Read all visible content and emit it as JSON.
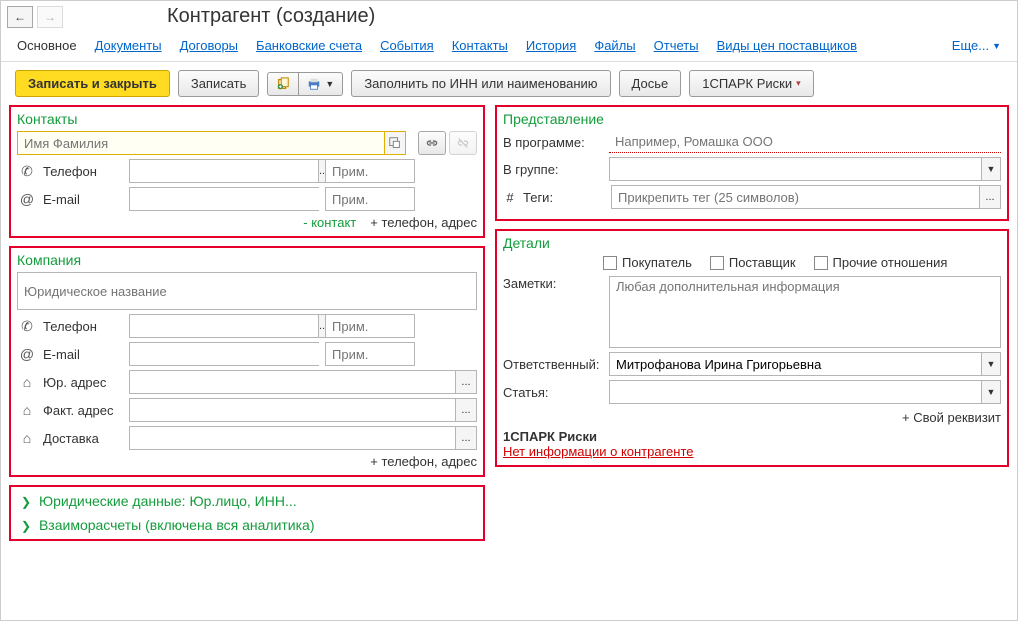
{
  "header": {
    "title": "Контрагент (создание)"
  },
  "tabs": {
    "main": "Основное",
    "docs": "Документы",
    "contracts": "Договоры",
    "bank": "Банковские счета",
    "events": "События",
    "contacts": "Контакты",
    "history": "История",
    "files": "Файлы",
    "reports": "Отчеты",
    "prices": "Виды цен поставщиков",
    "more": "Еще..."
  },
  "toolbar": {
    "save_close": "Записать и закрыть",
    "save": "Записать",
    "fill_inn": "Заполнить по ИНН или наименованию",
    "dossier": "Досье",
    "spark": "1СПАРК Риски"
  },
  "contacts_group": {
    "title": "Контакты",
    "name_placeholder": "Имя Фамилия",
    "phone_label": "Телефон",
    "email_label": "E-mail",
    "note_placeholder": "Прим.",
    "minus_contact": "- контакт",
    "plus_tel": "+ телефон, адрес"
  },
  "company_group": {
    "title": "Компания",
    "name_placeholder": "Юридическое название",
    "phone_label": "Телефон",
    "email_label": "E-mail",
    "legal_addr": "Юр. адрес",
    "fact_addr": "Факт. адрес",
    "delivery": "Доставка",
    "note_placeholder": "Прим.",
    "plus_tel": "+ телефон, адрес"
  },
  "legal_data_link": "Юридические данные: Юр.лицо, ИНН...",
  "settlements_link": "Взаиморасчеты (включена вся аналитика)",
  "repr_group": {
    "title": "Представление",
    "in_app": "В программе:",
    "in_app_ph": "Например, Ромашка ООО",
    "in_group": "В группе:",
    "tags": "Теги:",
    "tags_ph": "Прикрепить тег (25 символов)"
  },
  "details_group": {
    "title": "Детали",
    "buyer": "Покупатель",
    "supplier": "Поставщик",
    "other": "Прочие отношения",
    "notes_label": "Заметки:",
    "notes_ph": "Любая дополнительная информация",
    "responsible": "Ответственный:",
    "responsible_val": "Митрофанова Ирина Григорьевна",
    "article": "Статья:",
    "own_attr": "+ Свой реквизит",
    "spark_title": "1СПАРК Риски",
    "spark_warn": "Нет информации о контрагенте"
  }
}
